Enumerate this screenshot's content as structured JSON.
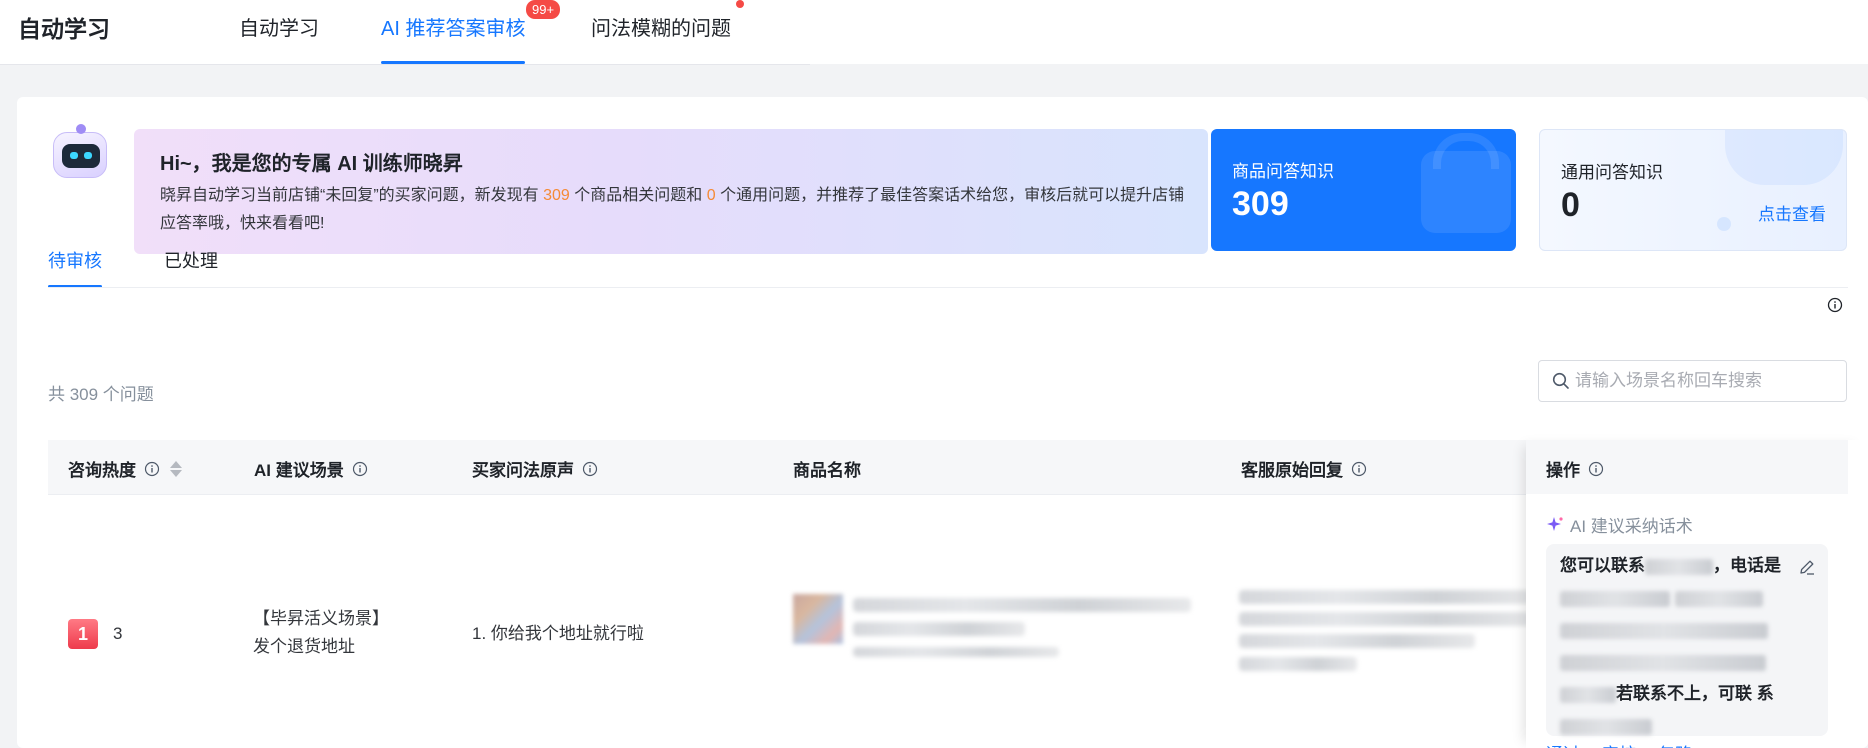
{
  "header": {
    "title": "自动学习",
    "tabs": [
      {
        "label": "自动学习"
      },
      {
        "label": "AI 推荐答案审核",
        "badge": "99+",
        "active": true
      },
      {
        "label": "问法模糊的问题",
        "dot": true
      }
    ]
  },
  "banner": {
    "title": "Hi~，我是您的专属 AI 训练师晓昇",
    "text_1": "晓昇自动学习当前店铺“未回复”的买家问题，新发现有 ",
    "product_count": "309",
    "text_2": " 个商品相关问题和 ",
    "general_count": "0",
    "text_3": " 个通用问题，并推荐了最佳答案话术给您，审核后就可以提升店铺应答率哦，快来看看吧!"
  },
  "stats": {
    "product_qa": {
      "label": "商品问答知识",
      "value": "309"
    },
    "general_qa": {
      "label": "通用问答知识",
      "value": "0",
      "link": "点击查看"
    }
  },
  "subtabs": [
    {
      "label": "待审核",
      "active": true
    },
    {
      "label": "已处理"
    }
  ],
  "summary": {
    "total": "共 309 个问题"
  },
  "search": {
    "placeholder": "请输入场景名称回车搜索"
  },
  "table": {
    "columns": [
      "咨询热度",
      "AI 建议场景",
      "买家问法原声",
      "商品名称",
      "客服原始回复",
      "操作"
    ],
    "rows": [
      {
        "rank": "1",
        "heat": "3",
        "scene_line1": "【毕昇活义场景】",
        "scene_line2": "发个退货地址",
        "question": "1. 你给我个地址就行啦",
        "ai_tip": "AI 建议采纳话术",
        "answer_part1": "您可以联系",
        "answer_part2": "，电话是",
        "answer_part3": "若联系不上，可联",
        "answer_part4": "系",
        "actions": [
          "通过",
          "审核",
          "忽略"
        ]
      }
    ]
  },
  "colors": {
    "accent": "#1677ff",
    "badge": "#f54a45",
    "highlight": "#f58a36",
    "rank": "#ee3b4c"
  }
}
